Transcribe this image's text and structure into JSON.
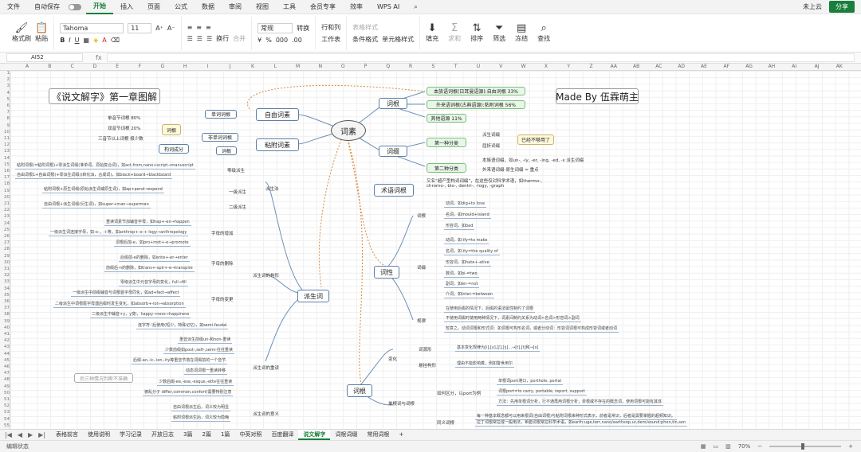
{
  "menubar": {
    "items": [
      "文件",
      "自动保存",
      "开始",
      "插入",
      "页面",
      "公式",
      "数据",
      "审阅",
      "视图",
      "工具",
      "会员专享",
      "效率",
      "WPS AI"
    ],
    "active": "开始",
    "cloud": "未上云",
    "share": "分享"
  },
  "ribbon": {
    "format_painter": "格式刷",
    "paste": "粘贴",
    "font_name": "Tahoma",
    "font_size": "11",
    "number_format": "常规",
    "convert": "转换",
    "rows_cols": "行和列",
    "worksheet": "工作表",
    "wrap": "换行",
    "merge": "合并",
    "cond_format": "条件格式",
    "cell_style": "单元格样式",
    "table_style": "表格样式",
    "fill": "填充",
    "sum": "求和",
    "sort": "排序",
    "filter": "筛选",
    "freeze": "冻结",
    "find": "查找"
  },
  "formula_bar": {
    "cell": "AI52",
    "fx": "fx",
    "value": ""
  },
  "columns": [
    "A",
    "B",
    "C",
    "D",
    "E",
    "F",
    "G",
    "H",
    "I",
    "J",
    "K",
    "L",
    "M",
    "N",
    "O",
    "P",
    "Q",
    "R",
    "S",
    "T",
    "U",
    "V",
    "W",
    "X",
    "Y",
    "Z",
    "AA",
    "AB",
    "AC",
    "AD",
    "AE",
    "AF",
    "AG",
    "AH",
    "AI",
    "AJ",
    "AK"
  ],
  "mindmap": {
    "title": "《说文解字》第一章图解",
    "author": "Made By 伍霖萌主",
    "center": "词素",
    "root": "词根",
    "affix": "词缀",
    "term_root": "术语词根",
    "part": "词性",
    "derivation": "派生词",
    "free_morpheme": "自由词素",
    "bound_morpheme": "粘附词素",
    "single_root": "单词词根",
    "nonsingle_root": "非单词词根",
    "root_small": "词根",
    "root_small2": "词根",
    "form_parts": "构词成分",
    "native_root": "本族语词根(日耳曼语源):自由词根 33%",
    "foreign_root": "外来语词根(古典语源):粘附词根 56%",
    "other_source": "其他语源 11%",
    "pct_80": "单音节词根 80%",
    "pct_20": "双音节词根 20%",
    "pct_few": "三音节以上词根 极少数",
    "first_class": "第一种分类",
    "second_class": "第二种分类",
    "prefix": "派生词缀",
    "inflect": "屈折词缀",
    "no_more": "已经不够用了",
    "first_text1": "本族语词缀，如un-, -ly, -er, -ing, -ed, -s 派生词缀",
    "first_text2": "外来语词缀-原生词缀 ≈ 重点",
    "term_text": "又名“超产型构词词缀”，在这些仅对科学术语，如thermo-, chromo-, bio-, dentri-, -logy, -graph",
    "deriv_zero": "零级派生",
    "deriv_one": "一级派生",
    "deriv_two": "二级派生",
    "deriv_zero_t1": "粘附词根(=粘附词根)+零派生词缀(准单词，原始复合词)，如act,from,nano+script→manuscript",
    "deriv_zero_t2": "自由词根1+自由词根(+零派生词缀)(转化派，合成词)，如black+board→blackboard",
    "deriv_one_t": "粘附词根+原生词缀(原始派生词或原生词)，如ap+pend→expend",
    "deriv_two_t": "自由词根+派生词缀(衍生词)，如super+man→superman",
    "deriv_label": "派生法",
    "add_letter": "字母的增加",
    "del_letter": "字母的删除",
    "change_letter": "字母的变更",
    "shape_change": "派生词的构形",
    "rep_text1": "重读词素节加辅音字母，如hap+-en→happen",
    "rep_text2": "一级派生词连接字母，如-o-，-i-等，如anthrop+-o-+-logy→anthropology",
    "rep_text3": "词根后加-e，如pro+mot+-e→promote",
    "del_text1": "后缀前-e的删除，如ente+-er→enter",
    "del_text2": "前缀后-n的删除，如trans+-spir+-e→transpire",
    "chg_text1": "零级派生中元音字母的变化，full→fill",
    "chg_text2": "一级派生中前缀辅音与词根首字母同化，如ad+fect→affect",
    "chg_text3": "二级派生中词根尾字母遇后缀时发生变化，如absorb+-ion→absorption",
    "chg_text4": "二级派生中辅音+y，y变i，happy→ness→happiness",
    "chg_text5": "连字符-'后使用(短少，特殊记忆)，如semi-feudal",
    "redup": "派生词的重读",
    "meaning": "派生词的意义",
    "red_text1": "重音派生前缀un-和non-重读",
    "red_text2": "少数前缀如post-,self-,semi-往往重读",
    "red_text3": "后缀-an,-ic,-ion,-ity等重音节落在词缀前的一个音节",
    "red_text4": "动态词词根一重读转移",
    "red_text5": "少数后缀-ee,-ese,-esque,-ette往往重读",
    "red_text6": "被乱分子 differ,common,confort)需要特别注意",
    "red_note": "后三种情况判断不准确",
    "mean_text1": "自由词根派生后，词义较为明显",
    "mean_text2": "粘附词根派生后，词义较为隐晦",
    "pos_verb": "动词，如dig+to love",
    "pos_noun": "名词，如mould+island",
    "pos_adj": "形容词，如bad",
    "pos_root": "词根",
    "aff_verb": "动词，如-ify=to make",
    "aff_noun": "名词，如-ity=the quality of",
    "aff_adj": "形容词，如hate+-ative",
    "aff_num": "数词，如bi-=two",
    "aff_neg": "副词，如en-=not",
    "aff_prep": "介词，如inter-=between",
    "aff_label": "词缀",
    "rules": "规律",
    "rule_t1": "在使用后缀的情况下，后缀的语法属性制约了词根",
    "rule_t2": "不使用词缀时使用两种情况下，词素间制约关系为动词>名词>形容词>副词",
    "rule_t3": "暂意之，动词词根和形式词：如词根可构形名词，或者分动词：形容词词根可构成形容词或者动词",
    "var": "变化",
    "var_flex": "词源形",
    "var_flex_t": "基本变化规律为[i],[y],[ʃ],[ʒ]...→[t],[t]和→[s]",
    "var_self": "悬挂构形",
    "var_self_t": "理由不能影响着，例如警世用尔",
    "root_bottom": "词根",
    "homonym": "单根词与词根",
    "how_to": "如何区分，以port为例",
    "port_t1": "单根词port港口，porthole, portal",
    "port_t2": "词根port=to carry, portable, report, support",
    "port_t3": "方法：先用单根词分析，行不通再用词根分析；单根或不存在的概念词，使用词根可能有其体",
    "same_sense": "同义词根",
    "same_t1": "每一种基本概念都可以用来根词(自由词根)与粘附词根来种形式表示，前者是常识，后者是需要掌握的超频知识。",
    "same_t2": "拉丁词根常拉成一般用法，希腊词根常拉科学术语，如earth:uge,terr,nano/earthsop,ur,dem/sound:phon,tin,son"
  },
  "tabs": [
    "表格前言",
    "使用说明",
    "学习记录",
    "开放日志",
    "3篇",
    "2篇",
    "1篇",
    "中英对照",
    "百度翻译",
    "说文解字",
    "词根词缀",
    "常用词根"
  ],
  "active_tab": "说文解字",
  "status": {
    "left": "编辑状态",
    "zoom": "70%"
  }
}
